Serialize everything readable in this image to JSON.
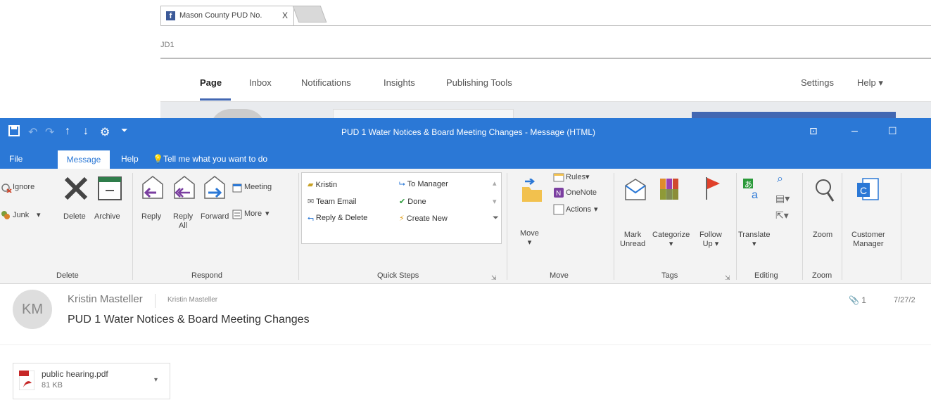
{
  "browser": {
    "tab_title": "Mason County PUD No.",
    "tab_close": "X",
    "address": "JD1",
    "nav": [
      "Page",
      "Inbox",
      "Notifications",
      "Insights",
      "Publishing Tools"
    ],
    "nav_right": [
      "Settings",
      "Help ▾"
    ]
  },
  "window": {
    "title": "PUD 1 Water Notices & Board Meeting Changes  -  Message (HTML)",
    "colors": {
      "accent": "#2b78d6",
      "ribbon_bg": "#f3f3f3"
    }
  },
  "tabs": {
    "file": "File",
    "message": "Message",
    "help": "Help",
    "tell_me": "Tell me what you want to do"
  },
  "ribbon": {
    "delete_group": {
      "ignore": "Ignore",
      "junk": "Junk",
      "delete": "Delete",
      "archive": "Archive",
      "label": "Delete"
    },
    "respond_group": {
      "reply": "Reply",
      "reply_all_1": "Reply",
      "reply_all_2": "All",
      "forward": "Forward",
      "meeting": "Meeting",
      "more": "More",
      "label": "Respond"
    },
    "quick_steps": {
      "items": [
        "Kristin",
        "To Manager",
        "Team Email",
        "Done",
        "Reply & Delete",
        "Create New"
      ],
      "label": "Quick Steps"
    },
    "move_group": {
      "move": "Move",
      "rules": "Rules",
      "onenote": "OneNote",
      "actions": "Actions",
      "label": "Move"
    },
    "tags_group": {
      "mark_1": "Mark",
      "mark_2": "Unread",
      "categorize": "Categorize",
      "follow_1": "Follow",
      "follow_2": "Up",
      "label": "Tags"
    },
    "editing_group": {
      "translate": "Translate",
      "label": "Editing"
    },
    "zoom_group": {
      "zoom": "Zoom",
      "label": "Zoom"
    },
    "customer": {
      "line1": "Customer",
      "line2": "Manager"
    }
  },
  "message": {
    "avatar_initials": "KM",
    "sender": "Kristin Masteller",
    "sender_small": "Kristin Masteller",
    "subject": "PUD 1 Water Notices & Board Meeting Changes",
    "attachment_count": "1",
    "date": "7/27/2"
  },
  "attachment": {
    "name": "public hearing.pdf",
    "size": "81 KB"
  }
}
